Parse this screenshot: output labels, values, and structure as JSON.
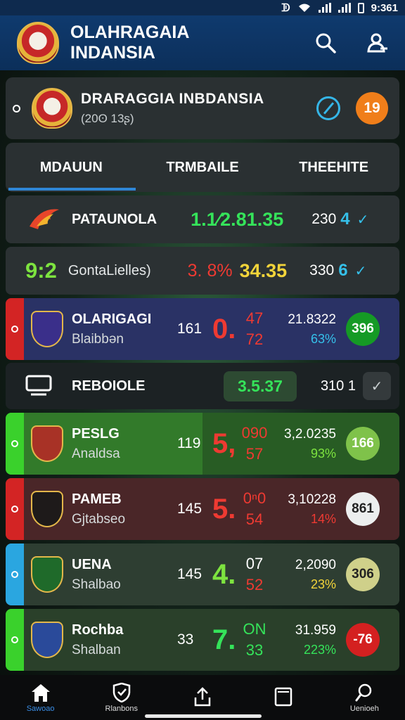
{
  "status": {
    "time": "9:361"
  },
  "app": {
    "title": "OLAHRAGAIA INDANSIA"
  },
  "header": {
    "title": "DRARAGGIA INBDANSIA",
    "subtitle": "(20ʘ 13ʂ)",
    "badge": "19"
  },
  "tabs": [
    "MDAUUN",
    "TRMBAILE",
    "THEEHITE"
  ],
  "rows": [
    {
      "name": "PATAUNOLA",
      "odds1": "1.1⁄2.",
      "odds2": "81.35",
      "value": "230",
      "count": "4"
    },
    {
      "name": "GontaLielles)",
      "score": "9:2",
      "odds1": "3. 8%",
      "odds2": "34.35",
      "value": "330",
      "count": "6"
    },
    {
      "name": "OLARIGAGI",
      "sub": "Blaibbən",
      "num": "161",
      "big": "0.",
      "top": "47",
      "bottom": "72",
      "r1": "21.8322",
      "r2": "63%",
      "badge": "396"
    },
    {
      "name": "REBOIOLE",
      "pill": "3.5.37",
      "value": "310 1"
    },
    {
      "name": "PESLG",
      "sub": "Analdsa",
      "num": "119",
      "big": "5,",
      "top": "090",
      "bottom": "57",
      "r1": "3,2.0235",
      "r2": "93%",
      "badge": "166"
    },
    {
      "name": "PAMEB",
      "sub": "Gjtabseo",
      "num": "145",
      "big": "5.",
      "top": "0ⁿ0",
      "bottom": "54",
      "r1": "3,10228",
      "r2": "14%",
      "badge": "861"
    },
    {
      "name": "UENA",
      "sub": "Shalbao",
      "num": "145",
      "big": "4.",
      "top": "07",
      "bottom": "52",
      "r1": "2,2090",
      "r2": "23%",
      "badge": "306"
    },
    {
      "name": "Rochba",
      "sub": "Shalban",
      "num": "33",
      "big": "7.",
      "top": "ON",
      "bottom": "33",
      "r1": "31.959",
      "r2": "223%",
      "badge": "-76"
    }
  ],
  "nav": [
    "Sawoao",
    "Rlanbons",
    "",
    "",
    "Uenioeh"
  ]
}
